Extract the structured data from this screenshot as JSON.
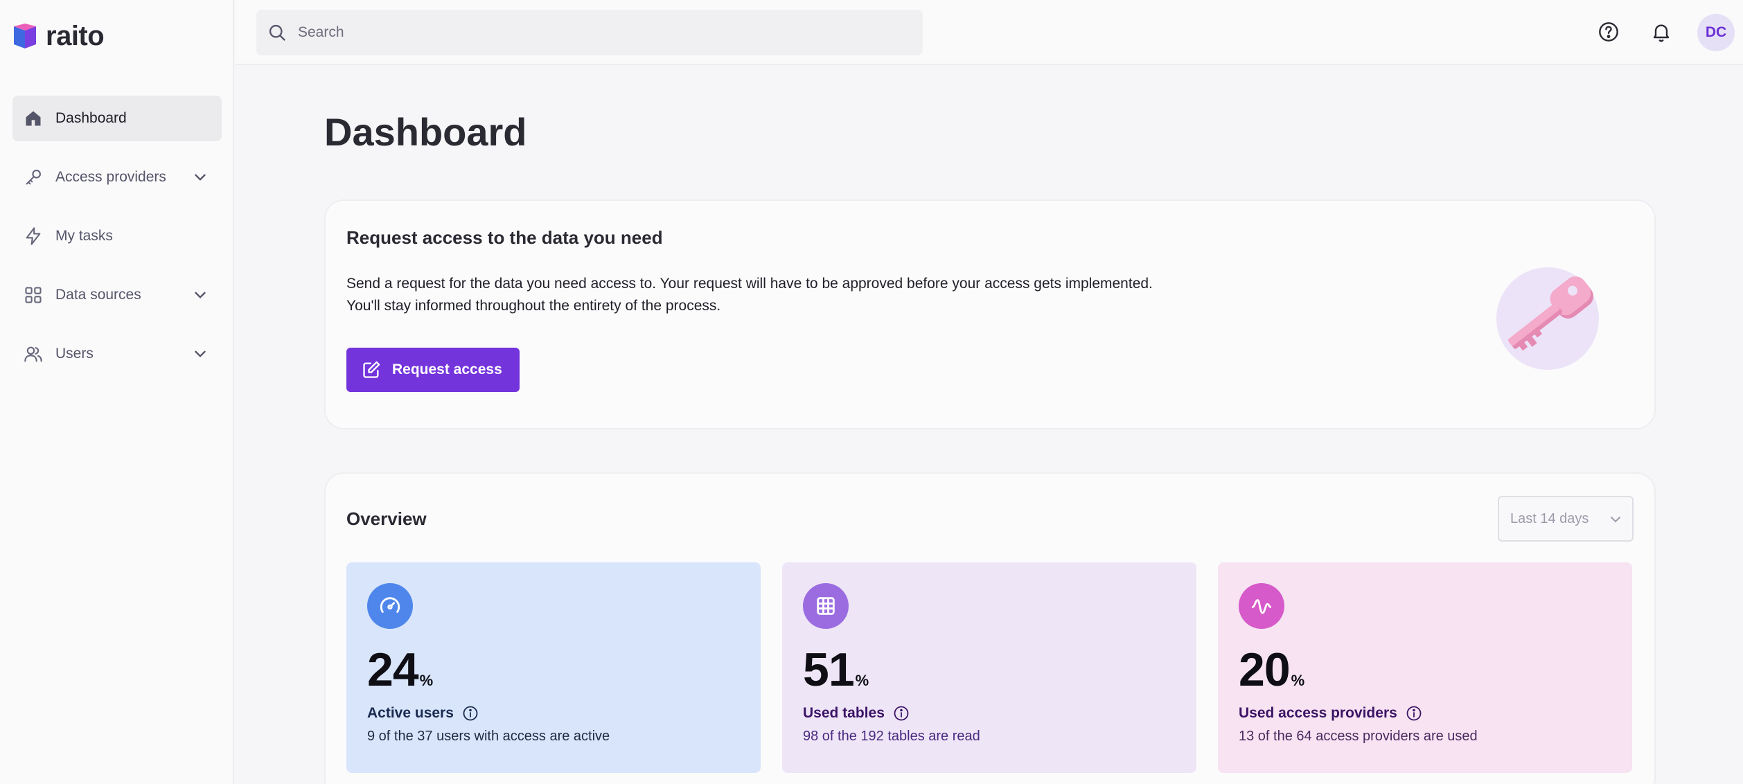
{
  "app": {
    "name": "raito"
  },
  "search": {
    "placeholder": "Search"
  },
  "header": {
    "avatar_initials": "DC",
    "icons": [
      "help-icon",
      "bell-icon"
    ]
  },
  "sidebar": {
    "items": [
      {
        "label": "Dashboard",
        "icon": "home-icon",
        "active": true,
        "expandable": false
      },
      {
        "label": "Access providers",
        "icon": "key-icon",
        "active": false,
        "expandable": true
      },
      {
        "label": "My tasks",
        "icon": "bolt-icon",
        "active": false,
        "expandable": false
      },
      {
        "label": "Data sources",
        "icon": "data-sources-icon",
        "active": false,
        "expandable": true
      },
      {
        "label": "Users",
        "icon": "users-icon",
        "active": false,
        "expandable": true
      }
    ]
  },
  "page": {
    "title": "Dashboard"
  },
  "request": {
    "title": "Request access to the data you need",
    "line1": "Send a request for the data you need access to. Your request will have to be approved before your access gets implemented.",
    "line2": "You'll stay informed throughout the entirety of the process.",
    "button_label": "Request access"
  },
  "overview": {
    "title": "Overview",
    "range": "Last 14 days",
    "stats": [
      {
        "value": "24",
        "unit": "%",
        "label": "Active users",
        "desc": "9 of the 37 users with access are active",
        "icon": "gauge-icon",
        "color": "#4f86ec"
      },
      {
        "value": "51",
        "unit": "%",
        "label": "Used tables",
        "desc": "98 of the 192 tables are read",
        "icon": "table-icon",
        "color": "#9b6ce0"
      },
      {
        "value": "20",
        "unit": "%",
        "label": "Used access providers",
        "desc": "13 of the 64 access providers are used",
        "icon": "activity-icon",
        "color": "#d65ac9"
      }
    ]
  },
  "colors": {
    "accent": "#7434dc",
    "background": "#f6f6f8"
  }
}
